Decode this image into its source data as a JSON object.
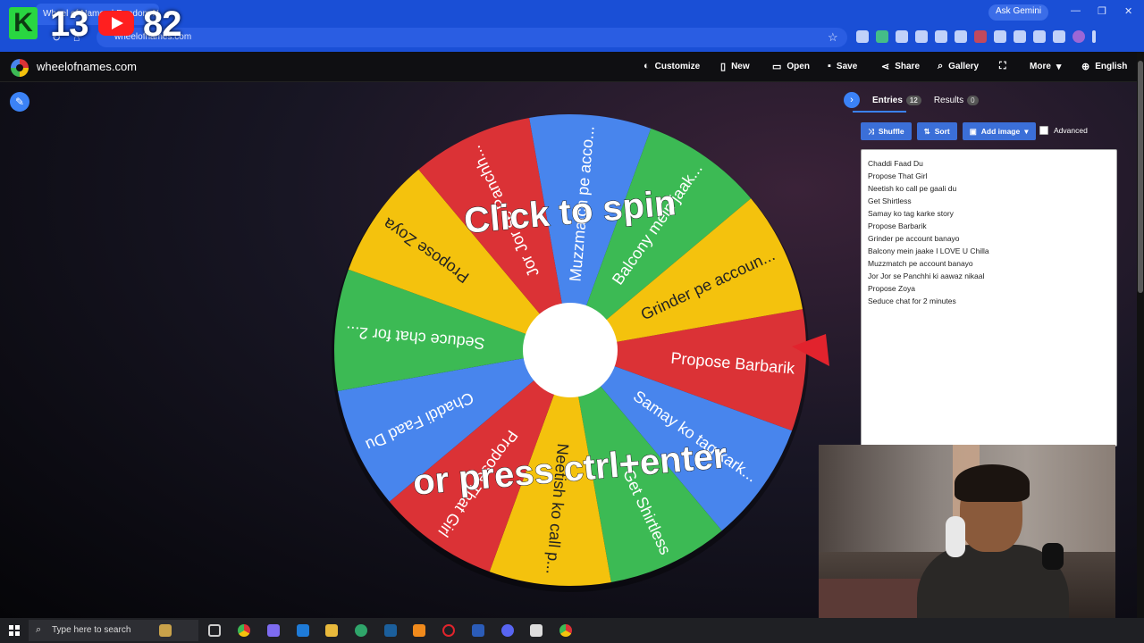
{
  "overlay": {
    "k_letter": "K",
    "left_number": "13",
    "right_number": "82"
  },
  "browser": {
    "tab_title": "Wheel of Names | Random Name",
    "url": "wheelofnames.com",
    "ask_gemini": "Ask Gemini"
  },
  "app": {
    "site_name": "wheelofnames.com",
    "menu": [
      {
        "label": "Customize",
        "icon": "palette-icon"
      },
      {
        "label": "New",
        "icon": "file-icon"
      },
      {
        "label": "Open",
        "icon": "folder-icon"
      },
      {
        "label": "Save",
        "icon": "save-icon"
      },
      {
        "label": "Share",
        "icon": "share-icon"
      },
      {
        "label": "Gallery",
        "icon": "search-icon"
      },
      {
        "label": "",
        "icon": "fullscreen-icon"
      },
      {
        "label": "More",
        "icon": "chevron-down-icon"
      },
      {
        "label": "English",
        "icon": "globe-icon"
      }
    ]
  },
  "wheel": {
    "center_text_top": "Click to spin",
    "center_text_bottom": "or press ctrl+enter",
    "segments": [
      {
        "label": "Propose Barbarik",
        "color": "#db3236"
      },
      {
        "label": "Samay ko tag kark...",
        "color": "#4885ed"
      },
      {
        "label": "Get Shirtless",
        "color": "#3cba54"
      },
      {
        "label": "Neetish ko call p...",
        "color": "#f4c20d"
      },
      {
        "label": "Propose That Girl",
        "color": "#db3236"
      },
      {
        "label": "Chaddi Faad Du",
        "color": "#4885ed"
      },
      {
        "label": "Seduce chat for 2...",
        "color": "#3cba54"
      },
      {
        "label": "Propose Zoya",
        "color": "#f4c20d"
      },
      {
        "label": "Jor Jor se Panchh...",
        "color": "#db3236"
      },
      {
        "label": "Muzzmatch pe acco...",
        "color": "#4885ed"
      },
      {
        "label": "Balcony mein jaak...",
        "color": "#3cba54"
      },
      {
        "label": "Grinder pe accoun...",
        "color": "#f4c20d"
      }
    ]
  },
  "sidebar": {
    "entries_tab": "Entries",
    "entries_count": "12",
    "results_tab": "Results",
    "results_count": "0",
    "shuffle": "Shuffle",
    "sort": "Sort",
    "add_image": "Add image",
    "advanced": "Advanced",
    "entries": [
      "Chaddi Faad Du",
      "Propose That Girl",
      "Neetish ko call pe gaali du",
      "Get Shirtless",
      "Samay ko tag karke story",
      "Propose Barbarik",
      "Grinder pe account banayo",
      "Balcony mein jaake I LOVE U Chilla",
      "Muzzmatch pe account banayo",
      "Jor Jor se Panchhi ki aawaz nikaal",
      "Propose Zoya",
      "Seduce chat for 2 minutes"
    ]
  },
  "taskbar": {
    "search_placeholder": "Type here to search"
  }
}
